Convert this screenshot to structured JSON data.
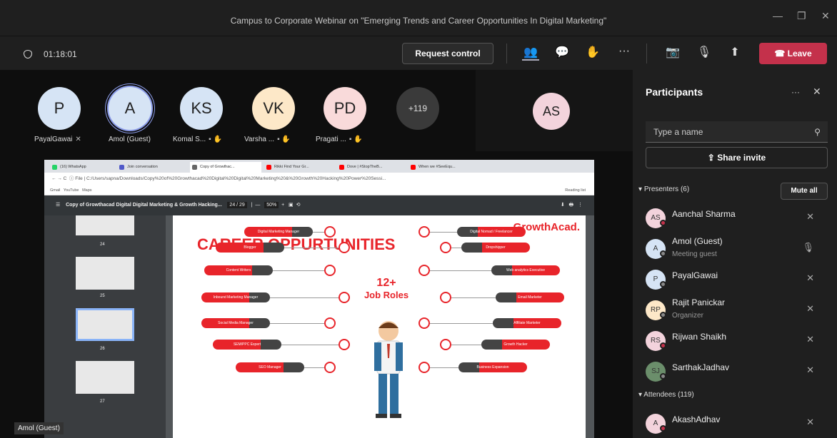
{
  "window": {
    "title": "Campus to Corporate Webinar on \"Emerging Trends and Career Opportunities In Digital Marketing\"",
    "minimize": "—",
    "maximize": "❐",
    "close": "✕"
  },
  "toolbar": {
    "timer": "01:18:01",
    "request_control": "Request control",
    "leave": "Leave",
    "icons": {
      "people": "👥",
      "chat": "💬",
      "react": "✋",
      "more": "···",
      "camera": "📷",
      "mic": "🎙",
      "share": "⬆",
      "phone": "☎"
    }
  },
  "gallery": {
    "avatars": [
      {
        "initials": "P",
        "name": "PayalGawai",
        "color": "#d6e4f5"
      },
      {
        "initials": "A",
        "name": "Amol (Guest)",
        "color": "#d6e4f5"
      },
      {
        "initials": "KS",
        "name": "Komal S...",
        "color": "#d6e4f5"
      },
      {
        "initials": "VK",
        "name": "Varsha ...",
        "color": "#fde8c8"
      },
      {
        "initials": "PD",
        "name": "Pragati ...",
        "color": "#f9dada"
      }
    ],
    "overflow": "+119",
    "side_avatar": "AS"
  },
  "browser": {
    "tabs": [
      "(16) WhatsApp",
      "Join conversation",
      "Copy of Growthac...",
      "Rikki Find Your Gr...",
      "Dove | #StopTheB...",
      "When we #SeeEqu..."
    ],
    "address": "C:/Users/sapna/Downloads/Copy%20of%20Growthacad%20Digital%20Digital%20Marketing%20&%20Growth%20Hacking%20Power%20Sessi...",
    "file_label": "File",
    "bookmarks": [
      "Gmail",
      "YouTube",
      "Maps"
    ],
    "reading_list": "Reading list"
  },
  "pdf": {
    "title": "Copy of Growthacad Digital Digital Marketing & Growth Hacking...",
    "page": "24 / 29",
    "zoom": "50%",
    "thumb_pages": [
      "24",
      "25",
      "26",
      "27"
    ],
    "slide": {
      "heading": "CAREER OPPURTUNITIES",
      "logo": "GrowthAcad.",
      "center": "12+",
      "center_sub": "Job Roles",
      "left_roles": [
        "Digital Marketing Manager",
        "Blogger",
        "Content Writers",
        "Inbound Marketing Manager",
        "Social Media Manager",
        "SEM/PPC Expert",
        "SEO Manager"
      ],
      "right_roles": [
        "Digital Nomad / Freelancer",
        "Dropshipper",
        "Web analytics Executive",
        "Email Marketer",
        "Affiliate Marketer",
        "Growth Hacker",
        "Business Expansion"
      ]
    }
  },
  "speaker_label": "Amol (Guest)",
  "panel": {
    "title": "Participants",
    "more": "···",
    "close": "✕",
    "search_placeholder": "Type a name",
    "share_invite": "Share invite",
    "presenters_label": "Presenters (6)",
    "mute_all": "Mute all",
    "attendees_label": "Attendees (119)",
    "presenters": [
      {
        "initials": "AS",
        "name": "Aanchal Sharma",
        "sub": "",
        "color": "#f3d3dc",
        "status": "#c4314b"
      },
      {
        "initials": "A",
        "name": "Amol (Guest)",
        "sub": "Meeting guest",
        "color": "#d6e4f5",
        "status": "#888"
      },
      {
        "initials": "P",
        "name": "PayalGawai",
        "sub": "",
        "color": "#d6e4f5",
        "status": "#888"
      },
      {
        "initials": "RP",
        "name": "Rajit Panickar",
        "sub": "Organizer",
        "color": "#fde8c8",
        "status": "#888"
      },
      {
        "initials": "RS",
        "name": "Rijwan Shaikh",
        "sub": "",
        "color": "#f3d3dc",
        "status": "#c4314b"
      },
      {
        "initials": "SJ",
        "name": "SarthakJadhav",
        "sub": "",
        "color": "#6b8e6b",
        "status": "#888"
      }
    ],
    "attendees": [
      {
        "initials": "A",
        "name": "AkashAdhav",
        "sub": "",
        "color": "#f3d3dc",
        "status": "#c4314b"
      }
    ]
  }
}
